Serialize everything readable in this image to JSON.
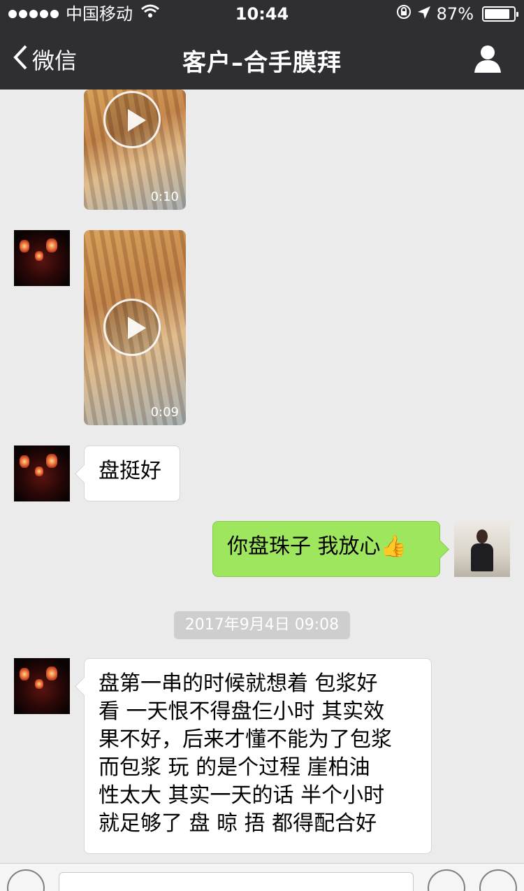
{
  "status_bar": {
    "carrier": "中国移动",
    "time": "10:44",
    "battery_percent": "87%",
    "battery_level": 0.87,
    "icons": [
      "signal-dots-icon",
      "wifi-icon",
      "orientation-lock-icon",
      "location-arrow-icon",
      "battery-icon"
    ]
  },
  "nav": {
    "back_label": "微信",
    "title": "客户–合手膜拜",
    "profile_icon": "person-icon"
  },
  "messages": [
    {
      "type": "video",
      "direction": "in",
      "duration": "0:10"
    },
    {
      "type": "video",
      "direction": "in",
      "duration": "0:09"
    },
    {
      "type": "text",
      "direction": "in",
      "text": "盘挺好"
    },
    {
      "type": "text",
      "direction": "out",
      "text": "你盘珠子  我放心",
      "emoji": "👍"
    },
    {
      "type": "timestamp",
      "text": "2017年9月4日 09:08"
    },
    {
      "type": "text",
      "direction": "in",
      "lines": [
        "盘第一串的时候就想着 包浆好",
        "看 一天恨不得盘仨小时 其实效",
        "果不好，后来才懂不能为了包浆",
        "而包浆 玩 的是个过程  崖柏油",
        "性太大 其实一天的话 半个小时",
        "就足够了 盘  晾  捂 都得配合好"
      ]
    }
  ],
  "colors": {
    "nav_bg": "#2e2e33",
    "chat_bg": "#ebebeb",
    "bubble_out": "#9fe65f",
    "bubble_in": "#ffffff"
  }
}
